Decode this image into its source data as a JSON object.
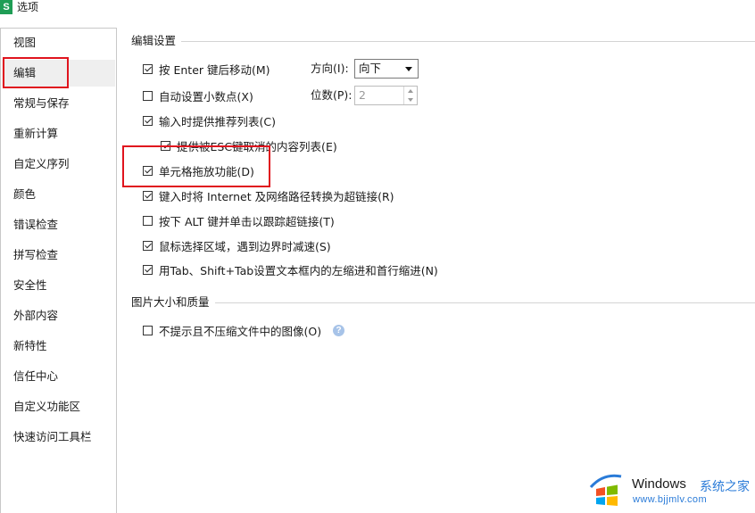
{
  "window": {
    "app_icon_letter": "S",
    "title": "选项"
  },
  "sidebar": {
    "items": [
      {
        "label": "视图"
      },
      {
        "label": "编辑",
        "selected": true
      },
      {
        "label": "常规与保存"
      },
      {
        "label": "重新计算"
      },
      {
        "label": "自定义序列"
      },
      {
        "label": "颜色"
      },
      {
        "label": "错误检查"
      },
      {
        "label": "拼写检查"
      },
      {
        "label": "安全性"
      },
      {
        "label": "外部内容"
      },
      {
        "label": "新特性"
      },
      {
        "label": "信任中心"
      },
      {
        "label": "自定义功能区"
      },
      {
        "label": "快速访问工具栏"
      }
    ]
  },
  "edit_settings": {
    "header": "编辑设置",
    "move_after_enter": {
      "label": "按 Enter 键后移动(M)",
      "checked": true
    },
    "direction": {
      "label": "方向(I):",
      "value": "向下"
    },
    "auto_decimal": {
      "label": "自动设置小数点(X)",
      "checked": false
    },
    "decimal_places": {
      "label": "位数(P):",
      "value": "2"
    },
    "autocomplete": {
      "label": "输入时提供推荐列表(C)",
      "checked": true
    },
    "esc_list": {
      "label": "提供被ESC键取消的内容列表(E)",
      "checked": true
    },
    "drag_drop": {
      "label": "单元格拖放功能(D)",
      "checked": true
    },
    "hyperlinks": {
      "label": "键入时将 Internet 及网络路径转换为超链接(R)",
      "checked": true
    },
    "alt_click": {
      "label": "按下 ALT 键并单击以跟踪超链接(T)",
      "checked": false
    },
    "slow_scroll": {
      "label": "鼠标选择区域，遇到边界时减速(S)",
      "checked": true
    },
    "tab_indent": {
      "label": "用Tab、Shift+Tab设置文本框内的左缩进和首行缩进(N)",
      "checked": true
    }
  },
  "image_settings": {
    "header": "图片大小和质量",
    "no_compress": {
      "label": "不提示且不压缩文件中的图像(O)",
      "checked": false
    },
    "help_glyph": "?"
  },
  "watermark": {
    "brand": "Windows",
    "cn": "系统之家",
    "url": "www.bjjmlv.com"
  },
  "colors": {
    "highlight": "#e0141e",
    "accent_green": "#1f9d55",
    "link_blue": "#2a7bd8"
  }
}
